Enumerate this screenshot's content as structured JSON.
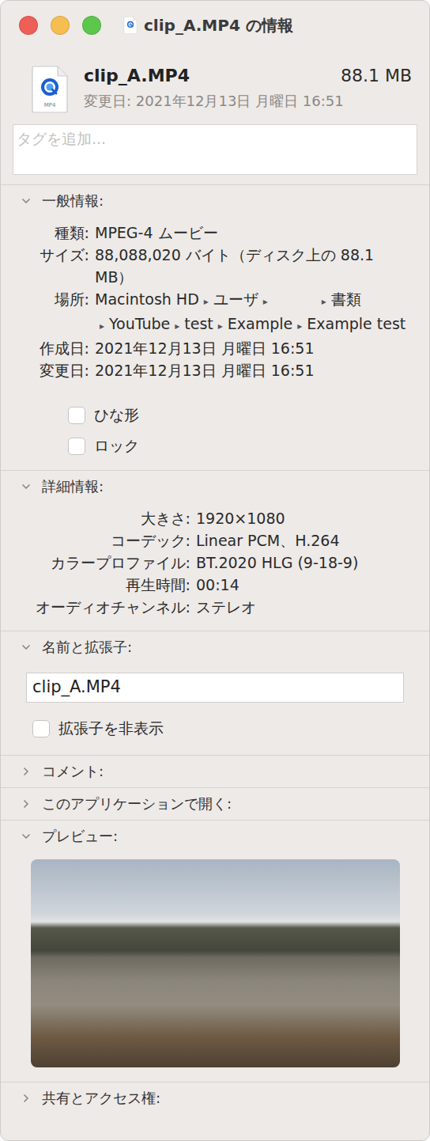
{
  "window": {
    "title": "clip_A.MP4 の情報"
  },
  "header": {
    "name": "clip_A.MP4",
    "size": "88.1 MB",
    "modified": "変更日: 2021年12月13日 月曜日 16:51",
    "icon_label": "MP4"
  },
  "tags": {
    "placeholder": "タグを追加..."
  },
  "sections": [
    {
      "kind": "general",
      "title": "一般情報:",
      "expanded": true,
      "rows": [
        {
          "kind": "text",
          "label": "種類:",
          "value": "MPEG-4 ムービー"
        },
        {
          "kind": "text",
          "label": "サイズ:",
          "value": "88,088,020 バイト（ディスク上の 88.1 MB）"
        },
        {
          "kind": "path",
          "label": "場所:",
          "separator": "▸",
          "segments": [
            {
              "text": "Macintosh HD",
              "redacted": false
            },
            {
              "text": "ユーザ",
              "redacted": false
            },
            {
              "text": "",
              "redacted": true
            },
            {
              "text": "書類",
              "redacted": false
            },
            {
              "text": "YouTube",
              "redacted": false
            },
            {
              "text": "test",
              "redacted": false
            },
            {
              "text": "Example",
              "redacted": false
            },
            {
              "text": "Example test",
              "redacted": false
            }
          ]
        },
        {
          "kind": "text",
          "label": "作成日:",
          "value": "2021年12月13日 月曜日 16:51"
        },
        {
          "kind": "text",
          "label": "変更日:",
          "value": "2021年12月13日 月曜日 16:51"
        }
      ],
      "checkboxes": [
        {
          "label": "ひな形",
          "checked": false
        },
        {
          "label": "ロック",
          "checked": false
        }
      ]
    },
    {
      "kind": "details",
      "title": "詳細情報:",
      "expanded": true,
      "rows": [
        {
          "label": "大きさ:",
          "value": "1920×1080"
        },
        {
          "label": "コーデック:",
          "value": "Linear PCM、H.264"
        },
        {
          "label": "カラープロファイル:",
          "value": "BT.2020 HLG (9-18-9)"
        },
        {
          "label": "再生時間:",
          "value": "00:14"
        },
        {
          "label": "オーディオチャンネル:",
          "value": "ステレオ"
        }
      ]
    },
    {
      "kind": "name",
      "title": "名前と拡張子:",
      "expanded": true,
      "value": "clip_A.MP4",
      "checkbox": {
        "label": "拡張子を非表示",
        "checked": false
      }
    },
    {
      "kind": "collapsed",
      "title": "コメント:",
      "expanded": false
    },
    {
      "kind": "collapsed",
      "title": "このアプリケーションで開く:",
      "expanded": false
    },
    {
      "kind": "preview",
      "title": "プレビュー:",
      "expanded": true
    },
    {
      "kind": "collapsed",
      "title": "共有とアクセス権:",
      "expanded": false
    }
  ]
}
